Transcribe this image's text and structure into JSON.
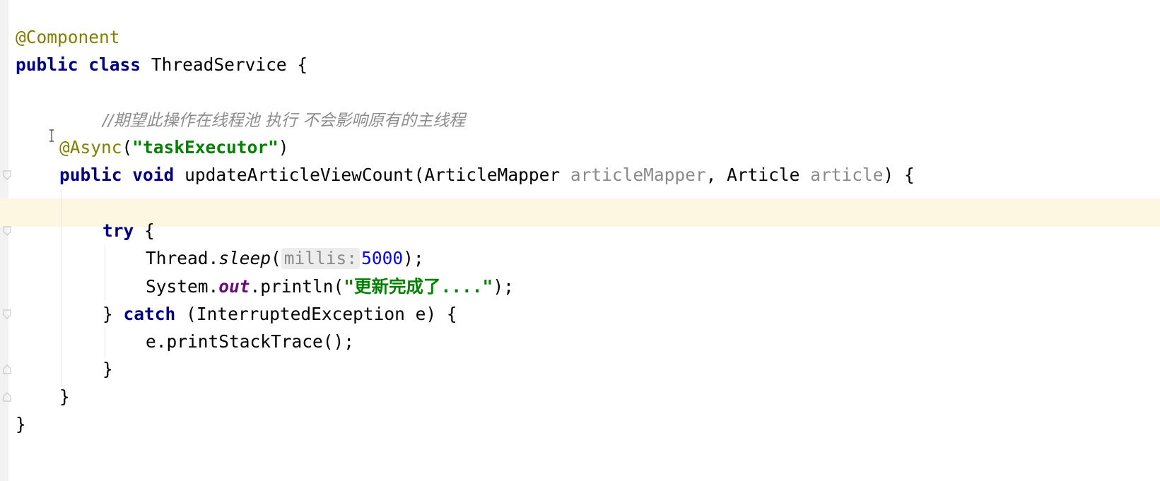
{
  "editor": {
    "language": "java",
    "colors": {
      "background": "#ffffff",
      "current_line": "#fdf7e2",
      "keyword": "#000080",
      "annotation": "#808000",
      "string": "#008000",
      "number": "#0000ff",
      "comment": "#8c8c8c",
      "parameter": "#8a8a8a",
      "static_field": "#660e7a"
    },
    "code": {
      "annotation_component": "@Component",
      "kw_public": "public",
      "kw_class": "class",
      "class_name": "ThreadService",
      "open_brace": "{",
      "close_brace": "}",
      "comment": "//期望此操作在线程池 执行 不会影响原有的主线程",
      "annotation_async": "@Async",
      "paren_open": "(",
      "paren_close": ")",
      "async_arg": "\"taskExecutor\"",
      "kw_void": "void",
      "method_name": "updateArticleViewCount",
      "param1_type": "ArticleMapper",
      "param1_name": "articleMapper",
      "comma": ",",
      "param2_type": "Article",
      "param2_name": "article",
      "kw_try": "try",
      "thread_call_prefix": "Thread.",
      "sleep_method": "sleep",
      "hint_label": "millis:",
      "sleep_value": "5000",
      "stmt_end": ");",
      "system_prefix": "System.",
      "out_field": "out",
      "println_call": ".println(",
      "println_arg": "\"更新完成了....\"",
      "kw_catch": "catch",
      "catch_params": "(InterruptedException e)",
      "print_stack": "e.printStackTrace();"
    },
    "icons": [
      "fold-marker-icon",
      "text-cursor-icon"
    ]
  }
}
